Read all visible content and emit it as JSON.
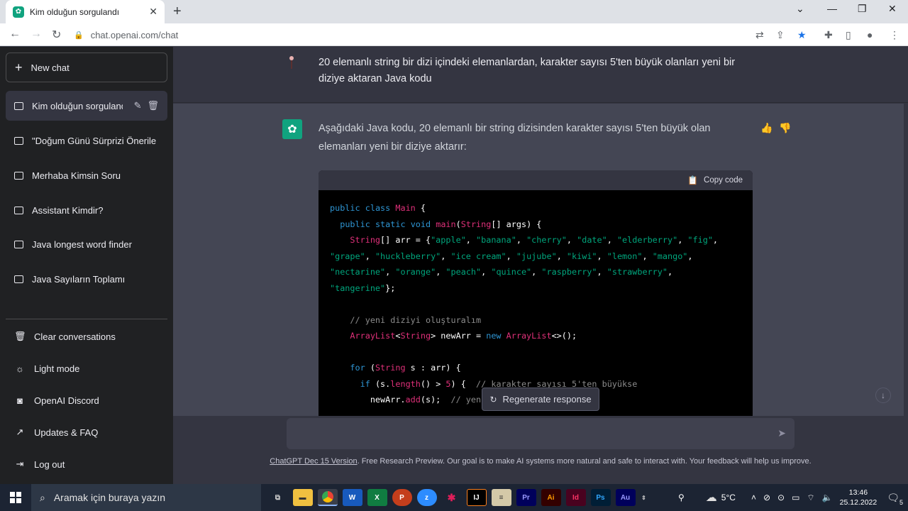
{
  "browser": {
    "tab_title": "Kim olduğun sorgulandı",
    "url": "chat.openai.com/chat"
  },
  "sidebar": {
    "new_chat": "New chat",
    "conversations": [
      "Kim olduğun sorgulandı",
      "\"Doğum Günü Sürprizi Önerile",
      "Merhaba Kimsin Soru",
      "Assistant Kimdir?",
      "Java longest word finder",
      "Java Sayıların Toplamı"
    ],
    "footer": [
      "Clear conversations",
      "Light mode",
      "OpenAI Discord",
      "Updates & FAQ",
      "Log out"
    ]
  },
  "chat": {
    "user_message": "20 elemanlı string bir dizi içindeki elemanlardan, karakter sayısı 5'ten büyük olanları yeni bir diziye aktaran Java kodu",
    "bot_message": "Aşağıdaki Java kodu, 20 elemanlı bir string dizisinden karakter sayısı 5'ten büyük olan elemanları yeni bir diziye aktarır:",
    "copy_code": "Copy code",
    "code": "public class Main {\n  public static void main(String[] args) {\n    String[] arr = {\"apple\", \"banana\", \"cherry\", \"date\", \"elderberry\", \"fig\",\n\"grape\", \"huckleberry\", \"ice cream\", \"jujube\", \"kiwi\", \"lemon\", \"mango\",\n\"nectarine\", \"orange\", \"peach\", \"quince\", \"raspberry\", \"strawberry\",\n\"tangerine\"};\n\n    // yeni diziyi oluşturalım\n    ArrayList<String> newArr = new ArrayList<>();\n\n    for (String s : arr) {\n      if (s.length() > 5) {  // karakter sayısı 5'ten büyükse\n        newArr.add(s);  // yeni"
  },
  "regenerate": "Regenerate response",
  "disclaimer_link": "ChatGPT Dec 15 Version",
  "disclaimer_text": ". Free Research Preview. Our goal is to make AI systems more natural and safe to interact with. Your feedback will help us improve.",
  "taskbar": {
    "search_placeholder": "Aramak için buraya yazın",
    "weather": "5°C",
    "time": "13:46",
    "date": "25.12.2022",
    "notifications": "5"
  }
}
